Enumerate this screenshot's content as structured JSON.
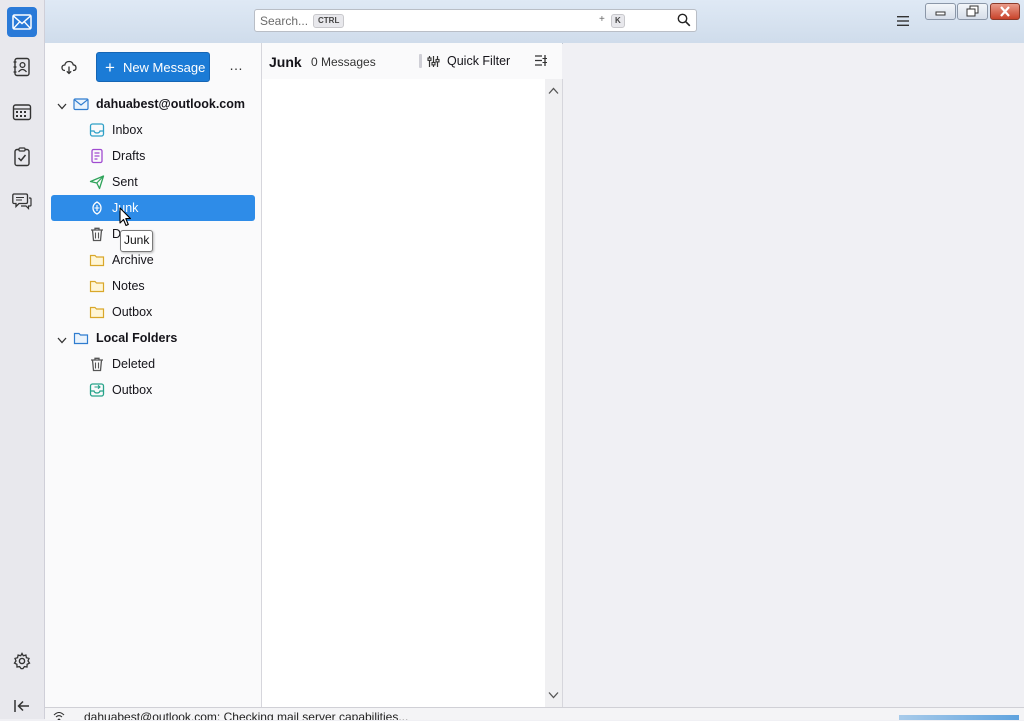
{
  "search": {
    "placeholder": "Search...",
    "shortcut_key1": "CTRL",
    "shortcut_plus": "+",
    "shortcut_key2": "K"
  },
  "spaces": {
    "items": [
      "mail-icon",
      "address-book-icon",
      "calendar-icon",
      "tasks-icon",
      "chat-icon"
    ],
    "bottom": [
      "settings-icon",
      "collapse-icon"
    ]
  },
  "folder_pane": {
    "new_message_label": "New Message",
    "more_label": "…",
    "accounts": [
      {
        "label": "dahuabest@outlook.com",
        "folders": [
          "Inbox",
          "Drafts",
          "Sent",
          "Junk",
          "D",
          "Archive",
          "Notes",
          "Outbox"
        ]
      },
      {
        "label": "Local Folders",
        "folders": [
          "Deleted",
          "Outbox"
        ]
      }
    ],
    "selected_folder": "Junk",
    "tooltip": "Junk"
  },
  "thread_pane": {
    "folder_title": "Junk",
    "message_count": "0 Messages",
    "quick_filter_label": "Quick Filter"
  },
  "status_bar": {
    "text": "dahuabest@outlook.com: Checking mail server capabilities..."
  },
  "colors": {
    "accent": "#2e8ce8",
    "new_message": "#1b7bd6"
  }
}
